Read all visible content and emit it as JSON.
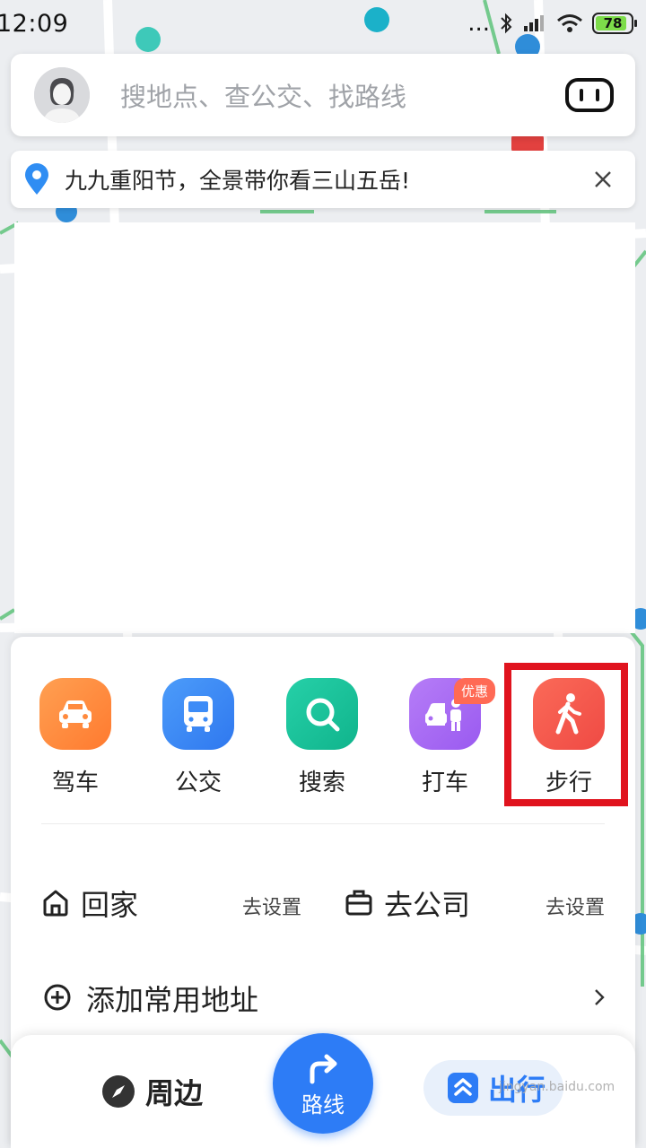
{
  "status_bar": {
    "time": "12:09",
    "battery": "78",
    "signal_text": "..."
  },
  "search": {
    "placeholder": "搜地点、查公交、找路线"
  },
  "banner": {
    "text": "九九重阳节，全景带你看三山五岳!"
  },
  "transport_modes": [
    {
      "label": "驾车",
      "color": "#ff8a3d",
      "icon": "car-icon"
    },
    {
      "label": "公交",
      "color": "#3d8cf7",
      "icon": "bus-icon"
    },
    {
      "label": "搜索",
      "color": "#17c29a",
      "icon": "search-icon"
    },
    {
      "label": "打车",
      "color": "#a96af3",
      "icon": "taxi-icon",
      "badge": "优惠"
    },
    {
      "label": "步行",
      "color": "#f45a4e",
      "icon": "walking-icon",
      "highlighted": true
    }
  ],
  "shortcuts": {
    "home_label": "回家",
    "home_action": "去设置",
    "company_label": "去公司",
    "company_action": "去设置",
    "add_label": "添加常用地址"
  },
  "bottom_nav": {
    "nearby_label": "周边",
    "route_label": "路线",
    "travel_label": "出行"
  },
  "watermark": {
    "text": "jingyan.baidu.com"
  },
  "colors": {
    "accent": "#2d7cf6",
    "highlight": "#e0131e",
    "map_road": "#5fc37b"
  }
}
